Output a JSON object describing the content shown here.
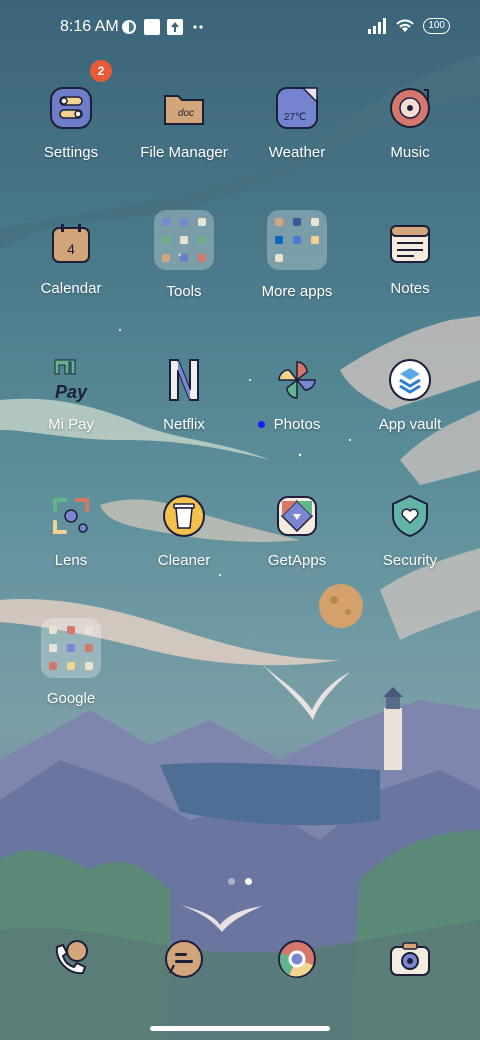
{
  "status_bar": {
    "time": "8:16 AM",
    "battery": "100",
    "icons": [
      "data-icon",
      "square-icon",
      "upload-icon",
      "more-dots-icon",
      "signal-icon",
      "wifi-icon",
      "battery-icon"
    ]
  },
  "home": {
    "apps": [
      {
        "label": "Settings",
        "icon": "settings-icon",
        "badge": "2"
      },
      {
        "label": "File Manager",
        "icon": "folder-doc-icon",
        "folder_text": "doc"
      },
      {
        "label": "Weather",
        "icon": "weather-icon",
        "temp_text": "27℃"
      },
      {
        "label": "Music",
        "icon": "music-disc-icon"
      },
      {
        "label": "Calendar",
        "icon": "calendar-icon",
        "date_text": "4"
      },
      {
        "label": "Tools",
        "icon": "folder-icon"
      },
      {
        "label": "More apps",
        "icon": "folder-icon"
      },
      {
        "label": "Notes",
        "icon": "notes-icon"
      },
      {
        "label": "Mi Pay",
        "icon": "mi-pay-icon",
        "logo_text": "Pay"
      },
      {
        "label": "Netflix",
        "icon": "netflix-icon",
        "logo_text": "N"
      },
      {
        "label": "Photos",
        "icon": "photos-pinwheel-icon"
      },
      {
        "label": "App vault",
        "icon": "app-vault-icon"
      },
      {
        "label": "Lens",
        "icon": "lens-icon"
      },
      {
        "label": "Cleaner",
        "icon": "cleaner-icon"
      },
      {
        "label": "GetApps",
        "icon": "getapps-icon"
      },
      {
        "label": "Security",
        "icon": "security-shield-icon"
      },
      {
        "label": "Google",
        "icon": "folder-icon"
      }
    ]
  },
  "dock": [
    {
      "name": "phone",
      "icon": "phone-icon"
    },
    {
      "name": "messages",
      "icon": "messages-icon"
    },
    {
      "name": "chrome",
      "icon": "chrome-icon"
    },
    {
      "name": "camera",
      "icon": "camera-icon"
    }
  ],
  "page_indicator": {
    "pages": 2,
    "active": 2
  }
}
